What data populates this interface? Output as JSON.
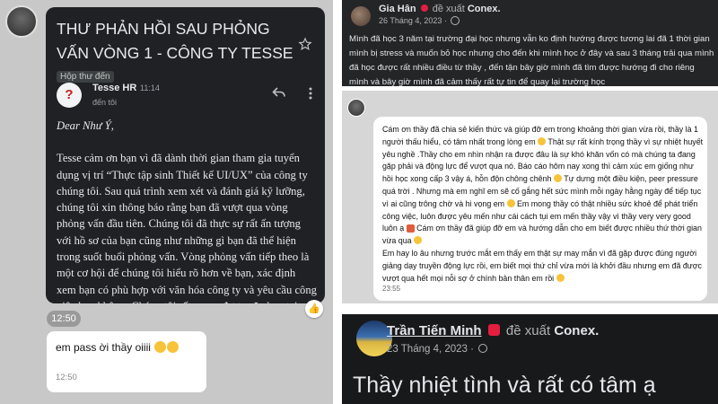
{
  "email_thread": {
    "subject": "THƯ PHẢN HỒI SAU PHỎNG VẤN VÒNG 1 - CÔNG TY TESSE",
    "folder_chip": "Hộp thư đến",
    "sender_name": "Tesse HR",
    "send_time": "11:14",
    "recipient": "đến tôi",
    "greeting": "Dear Như Ý,",
    "body": "Tesse cảm ơn bạn vì đã dành thời gian tham gia tuyển dụng vị trí “Thực tập sinh Thiết kế UI/UX” của công ty chúng tôi. Sau quá trình xem xét và đánh giá kỹ lưỡng, chúng tôi xin thông báo rằng bạn đã vượt qua vòng phỏng vấn đầu tiên. Chúng tôi đã thực sự rất ấn tượng với hồ sơ của bạn cũng như những gì bạn đã thể hiện trong suốt buổi phỏng vấn. Vòng phỏng vấn tiếp theo là một cơ hội để chúng tôi hiểu rõ hơn về bạn, xác định xem bạn có phù hợp với văn hóa công ty và yêu cầu công việc hay không. Chúng tôi rất mong được gặp bạn tại vòng phỏng vấn tiếp theo. Thông tin cụ thể như sau:"
  },
  "chat": {
    "timestamp_pill": "12:50",
    "message_text": "em pass ời thầy oiiii",
    "message_time": "12:50"
  },
  "post1": {
    "author": "Gia Hân",
    "verb": "đề xuất",
    "org": "Conex.",
    "date": "26 Tháng 4, 2023 ·",
    "text": "Mình đã học 3 năm tại trường đại học nhưng vẫn ko định hướng được tương lai đã 1 thời gian mình bị stress và muốn bỏ học nhưng cho đến khi mình học ở đây và sau 3 tháng trải qua mình đã học được rất nhiều điều từ thầy , đến tận bây giờ mình đã tìm được hướng đi cho riêng mình và bây giờ mình đã cảm thấy rất tự tin để quay lại trường học"
  },
  "message2": {
    "part1": "Cám ơn thầy đã chia sẻ kiến thức và giúp đỡ em trong khoảng thời gian vừa rồi, thầy là 1 người thấu hiểu, có tâm nhất trong lòng em",
    "part2": "Thật sự rất kính trọng thầy vì sự nhiệt huyết yêu nghề .Thầy cho em nhìn nhận ra được đâu là sự khó khăn vốn có mà chúng ta đang gặp phải và động lực để vượt qua nó. Báo cáo hôm nay xong thì cảm xúc em giống như hồi học xong cấp 3 vậy á, hỗn độn chông chênh",
    "part3": "Tự dưng một điều kiện, peer pressure quá trời .  Nhưng mà em nghĩ em sẽ cố gắng hết sức mình mỗi ngày hằng ngày để tiếp tục vì ai cũng trông chờ và hi vọng em",
    "part4": "Em mong thầy có thật nhiều sức khoẻ để phát triển công việc, luôn được yêu mến như cái cách tụi em mến thầy vậy vì thầy very very good luôn ạ",
    "part5": "Cám ơn thầy đã giúp đỡ em và hướng dẫn cho em biết được nhiều thứ thời gian vừa qua",
    "part6": "Em hay lo âu nhưng trước mắt em thấy em  thật sự may mắn vì đã gặp được đúng người giảng dạy truyền động lực rồi, em biết mọi thứ chỉ vừa mới là khởi đầu nhưng em đã được vượt qua hết mọi nỗi sợ ở chính bản thân em rồi",
    "time": "23:55"
  },
  "post3": {
    "author": "Trần Tiến Minh",
    "verb": "đề xuất",
    "org": "Conex.",
    "date": "23 Tháng 4, 2023 ·",
    "text": "Thầy nhiệt tình và rất có tâm ạ"
  },
  "icons": [
    "star-icon",
    "reply-icon",
    "more-vert-icon",
    "thumbs-up-icon",
    "recommend-icon",
    "globe-icon"
  ],
  "colors": {
    "email_bg": "#202124",
    "fb_dark": "#242526",
    "recommend_red": "#e41e3f"
  }
}
